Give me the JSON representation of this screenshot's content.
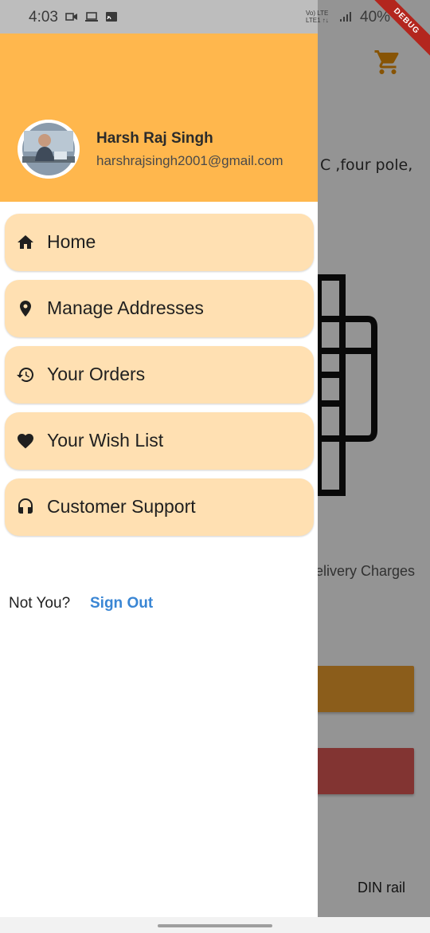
{
  "status_bar": {
    "time": "4:03",
    "network_top": "Vo) LTE",
    "network_bottom": "LTE1 ↑↓",
    "battery": "40%",
    "debug_banner": "DEBUG"
  },
  "background": {
    "description_snippet": "C ,four pole,",
    "delivery_text": "elivery Charges",
    "din_text": "DIN rail",
    "cart_color": "#e8910a",
    "button1_color": "#f0a030",
    "button2_color": "#e05a57"
  },
  "drawer": {
    "header_color": "#ffb74d",
    "user": {
      "name": "Harsh Raj Singh",
      "email": "harshrajsingh2001@gmail.com"
    },
    "menu": [
      {
        "label": "Home",
        "icon": "home-icon"
      },
      {
        "label": "Manage Addresses",
        "icon": "location-pin-icon"
      },
      {
        "label": "Your Orders",
        "icon": "history-icon"
      },
      {
        "label": "Your Wish List",
        "icon": "heart-icon"
      },
      {
        "label": "Customer Support",
        "icon": "headset-icon"
      }
    ],
    "menu_bg": "#ffe0b2",
    "footer": {
      "prompt": "Not You?",
      "sign_out": "Sign Out",
      "sign_out_color": "#3a86d4"
    }
  }
}
